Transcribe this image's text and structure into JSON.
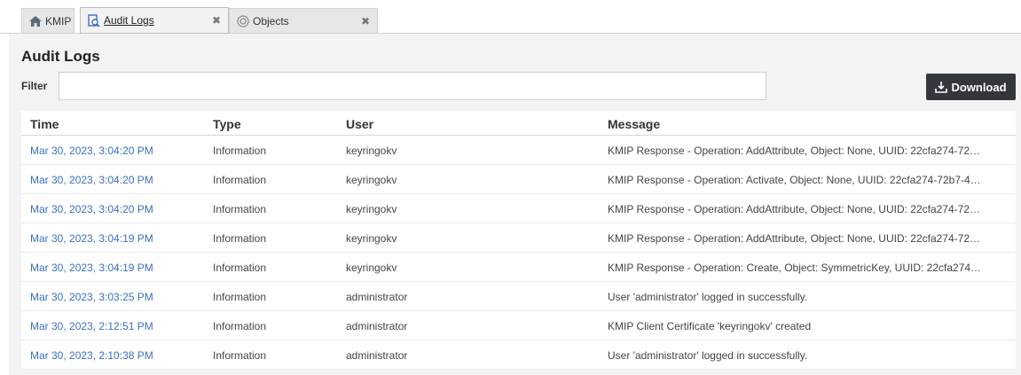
{
  "tabs": [
    {
      "label": "KMIP",
      "icon": "home-icon",
      "closable": false,
      "active": false
    },
    {
      "label": "Audit Logs",
      "icon": "log-search-icon",
      "closable": true,
      "active": true
    },
    {
      "label": "Objects",
      "icon": "objects-icon",
      "closable": true,
      "active": false
    }
  ],
  "tab_close_glyph": "✖",
  "page": {
    "title": "Audit Logs",
    "filter_label": "Filter",
    "filter_value": "",
    "download_label": "Download"
  },
  "table": {
    "columns": [
      "Time",
      "Type",
      "User",
      "Message"
    ],
    "rows": [
      {
        "time": "Mar 30, 2023, 3:04:20 PM",
        "type": "Information",
        "user": "keyringokv",
        "message": "KMIP Response - Operation: AddAttribute, Object: None, UUID: 22cfa274-72…"
      },
      {
        "time": "Mar 30, 2023, 3:04:20 PM",
        "type": "Information",
        "user": "keyringokv",
        "message": "KMIP Response - Operation: Activate, Object: None, UUID: 22cfa274-72b7-4…"
      },
      {
        "time": "Mar 30, 2023, 3:04:20 PM",
        "type": "Information",
        "user": "keyringokv",
        "message": "KMIP Response - Operation: AddAttribute, Object: None, UUID: 22cfa274-72…"
      },
      {
        "time": "Mar 30, 2023, 3:04:19 PM",
        "type": "Information",
        "user": "keyringokv",
        "message": "KMIP Response - Operation: AddAttribute, Object: None, UUID: 22cfa274-72…"
      },
      {
        "time": "Mar 30, 2023, 3:04:19 PM",
        "type": "Information",
        "user": "keyringokv",
        "message": "KMIP Response - Operation: Create, Object: SymmetricKey, UUID: 22cfa274…"
      },
      {
        "time": "Mar 30, 2023, 3:03:25 PM",
        "type": "Information",
        "user": "administrator",
        "message": "User 'administrator' logged in successfully."
      },
      {
        "time": "Mar 30, 2023, 2:12:51 PM",
        "type": "Information",
        "user": "administrator",
        "message": "KMIP Client Certificate 'keyringokv' created"
      },
      {
        "time": "Mar 30, 2023, 2:10:38 PM",
        "type": "Information",
        "user": "administrator",
        "message": "User 'administrator' logged in successfully."
      }
    ]
  },
  "colors": {
    "link": "#3a6fc4",
    "download_bg": "#33373d",
    "panel_bg": "#f3f3f3"
  }
}
